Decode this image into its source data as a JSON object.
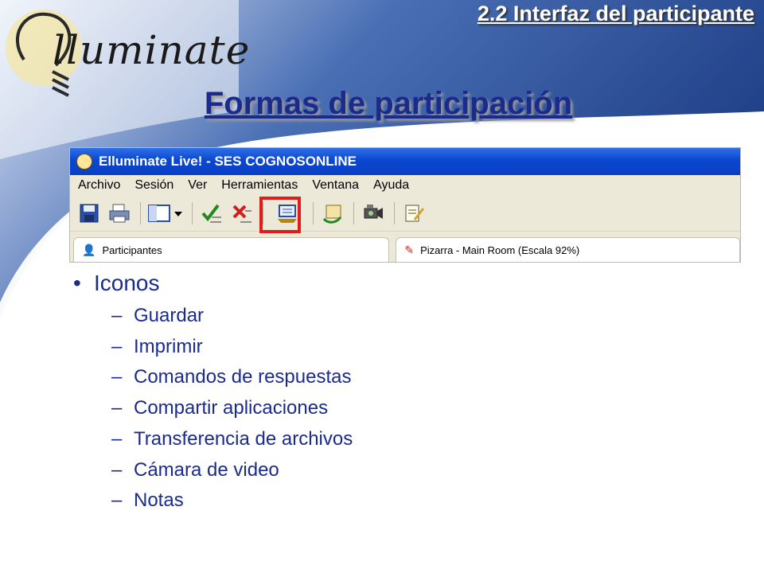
{
  "header": {
    "section_link": "2.2 Interfaz del participante"
  },
  "logo": {
    "text": "lluminate",
    "brand": "Elluminate",
    "icon": "lightbulb-icon"
  },
  "slide": {
    "title": "Formas de participación"
  },
  "app_window": {
    "title": "Elluminate Live! - SES COGNOSONLINE",
    "menu": [
      "Archivo",
      "Sesión",
      "Ver",
      "Herramientas",
      "Ventana",
      "Ayuda"
    ],
    "toolbar_icons": [
      "save-icon",
      "print-icon",
      "layout-icon",
      "check-icon",
      "cross-check-icon",
      "share-app-icon",
      "file-transfer-icon",
      "video-camera-icon",
      "notes-icon"
    ],
    "highlighted_icon": "share-app-icon",
    "panels": {
      "participants": "Participantes",
      "whiteboard": "Pizarra - Main Room (Escala 92%)"
    }
  },
  "bullets": {
    "heading": "Iconos",
    "items": [
      "Guardar",
      "Imprimir",
      "Comandos de respuestas",
      "Compartir aplicaciones",
      "Transferencia de archivos",
      "Cámara de video",
      "Notas"
    ]
  },
  "colors": {
    "title_blue": "#1b2b8c",
    "highlight_red": "#e21b1b",
    "window_blue": "#0a47cf"
  }
}
